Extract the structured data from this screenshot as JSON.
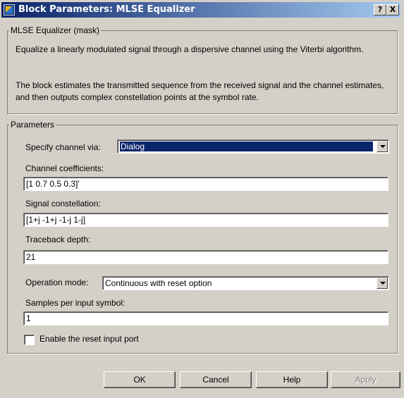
{
  "window": {
    "title": "Block Parameters: MLSE Equalizer",
    "help_btn": "?",
    "close_btn": "X"
  },
  "mask": {
    "legend": "MLSE Equalizer (mask)",
    "description1": "Equalize a linearly modulated signal through a dispersive channel using the Viterbi algorithm.",
    "description2": "The block estimates the transmitted sequence from the received signal and the channel estimates, and then outputs complex constellation points at the symbol rate."
  },
  "params": {
    "legend": "Parameters",
    "specify_channel_label": "Specify channel via:",
    "specify_channel_value": "Dialog",
    "channel_coeff_label": "Channel coefficients:",
    "channel_coeff_value": "[1 0.7 0.5 0.3]'",
    "signal_const_label": "Signal constellation:",
    "signal_const_value": "[1+j -1+j -1-j 1-j]",
    "traceback_label": "Traceback depth:",
    "traceback_value": "21",
    "operation_mode_label": "Operation mode:",
    "operation_mode_value": "Continuous with reset option",
    "samples_label": "Samples per input symbol:",
    "samples_value": "1",
    "reset_port_label": "Enable the reset input port",
    "reset_port_checked": false
  },
  "buttons": {
    "ok": "OK",
    "cancel": "Cancel",
    "help": "Help",
    "apply": "Apply"
  }
}
